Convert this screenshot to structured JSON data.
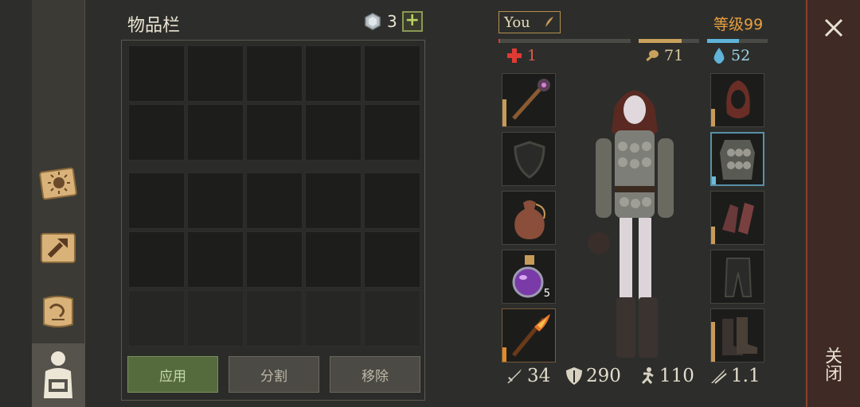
{
  "inventory": {
    "title": "物品栏",
    "gem_count": "3",
    "plus_label": "+",
    "buttons": {
      "use": "应用",
      "split": "分割",
      "remove": "移除"
    }
  },
  "character": {
    "name": "You",
    "level": "等级99",
    "health": "1",
    "food": "71",
    "water": "52",
    "potion_count": "5",
    "stats": {
      "attack": "34",
      "armor": "290",
      "speed": "110",
      "weight": "1.1"
    }
  },
  "close_label": "关闭",
  "colors": {
    "accent_orange": "#e8a040",
    "health_red": "#e03a34",
    "water_blue": "#5fb4d8",
    "close_red": "#8c3e30"
  }
}
